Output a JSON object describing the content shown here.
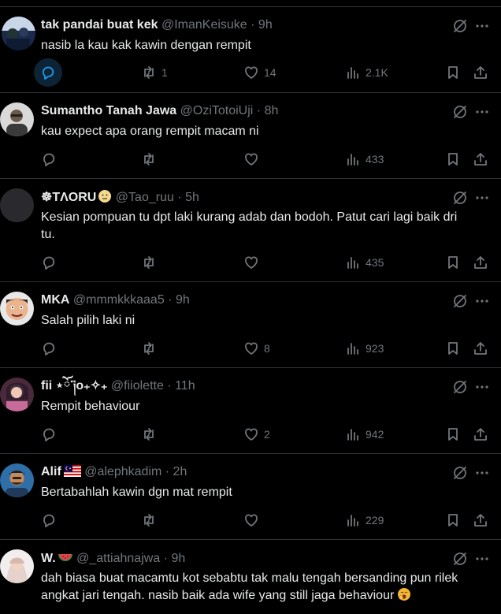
{
  "tweets": [
    {
      "name": "tak pandai buat kek",
      "handle": "@ImanKeisuke",
      "time": "9h",
      "lines": [
        "nasib la kau kak kawin dengan rempit"
      ],
      "replies": "",
      "retweets": "1",
      "likes": "14",
      "views": "2.1K",
      "reply_highlighted": true
    },
    {
      "name": "Sumantho Tanah Jawa",
      "handle": "@OziTotoiUji",
      "time": "8h",
      "lines": [
        "kau expect apa orang rempit macam ni"
      ],
      "replies": "",
      "retweets": "",
      "likes": "",
      "views": "433"
    },
    {
      "name": "☸︎TΛORU",
      "handle": "@Tao_ruu",
      "time": "5h",
      "lines": [
        "Kesian pompuan tu dpt laki kurang adab dan bodoh. Patut cari lagi baik dri",
        "tu."
      ],
      "replies": "",
      "retweets": "",
      "likes": "",
      "views": "435"
    },
    {
      "name": "MKA",
      "handle": "@mmmkkkaaa5",
      "time": "9h",
      "lines": [
        "Salah pilih laki ni"
      ],
      "replies": "",
      "retweets": "",
      "likes": "8",
      "views": "923"
    },
    {
      "name": "fii ⋆ོ་༏o₊✧₊",
      "handle": "@fiiolette",
      "time": "11h",
      "lines": [
        "Rempit behaviour"
      ],
      "replies": "",
      "retweets": "",
      "likes": "2",
      "views": "942"
    },
    {
      "name": "Alif",
      "handle": "@alephkadim",
      "time": "2h",
      "lines": [
        "Bertabahlah kawin dgn mat rempit"
      ],
      "replies": "",
      "retweets": "",
      "likes": "",
      "views": "229"
    },
    {
      "name": "W.",
      "handle": "@_attiahnajwa",
      "time": "9h",
      "lines": [
        "dah biasa buat macamtu kot sebabtu tak malu tengah bersanding pun rilek",
        "angkat jari tengah. nasib baik ada wife yang still jaga behaviour"
      ],
      "replies": "",
      "retweets": "",
      "likes": "",
      "views": ""
    }
  ],
  "separator": "·",
  "icons": {
    "mute": "mute-circle-slash-icon",
    "more": "more-dots-icon",
    "reply": "reply-bubble-icon",
    "retweet": "retweet-icon",
    "like": "heart-icon",
    "views": "views-bars-icon",
    "bookmark": "bookmark-icon",
    "share": "share-upload-icon"
  },
  "colors": {
    "background": "#000000",
    "text": "#e7e9ea",
    "muted": "#71767b",
    "divider": "#2f3336",
    "reply_highlight": "#0d2437",
    "reply_highlight_icon": "#1d9bf0"
  }
}
